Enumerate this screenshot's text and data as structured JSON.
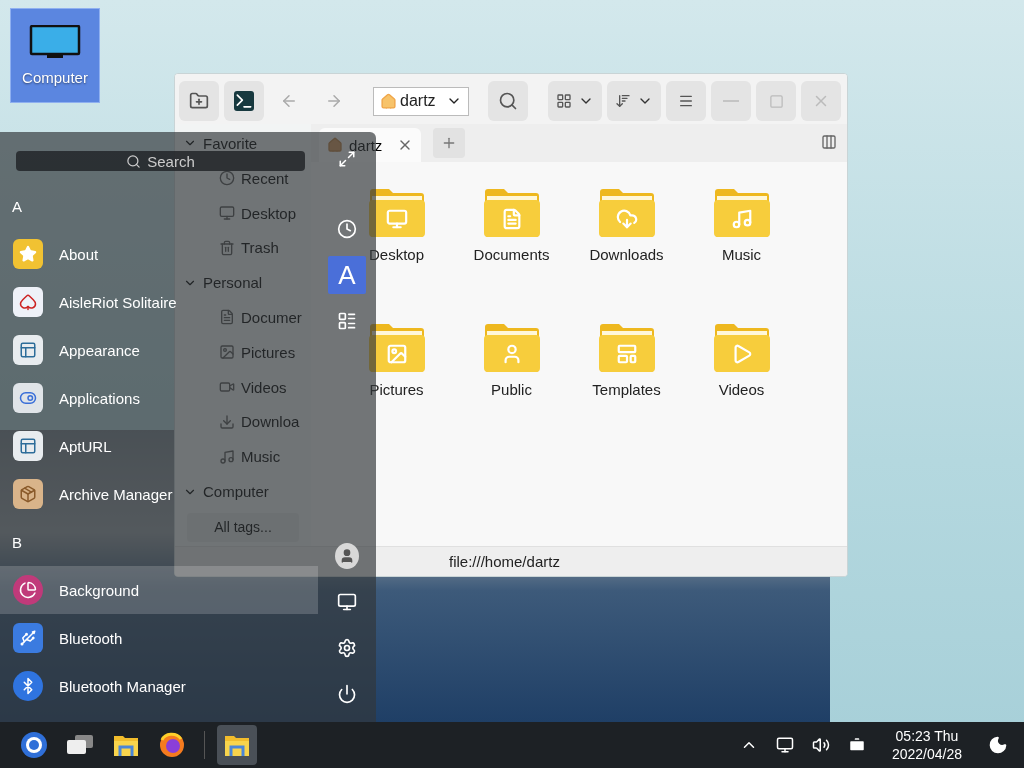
{
  "desktop_icons": [
    {
      "label": "Computer",
      "selected": true
    }
  ],
  "file_manager": {
    "location": "dartz",
    "tabs": [
      {
        "label": "dartz",
        "selected": true
      }
    ],
    "sidebar": [
      {
        "label": "Favorite",
        "expanded": true,
        "children": [
          {
            "label": "Recent",
            "kind": "recent"
          },
          {
            "label": "Desktop",
            "kind": "desktop"
          },
          {
            "label": "Trash",
            "kind": "trash"
          }
        ]
      },
      {
        "label": "Personal",
        "expanded": true,
        "children": [
          {
            "label": "Documer",
            "kind": "documents"
          },
          {
            "label": "Pictures",
            "kind": "pictures"
          },
          {
            "label": "Videos",
            "kind": "videos"
          },
          {
            "label": "Downloa",
            "kind": "downloads"
          },
          {
            "label": "Music",
            "kind": "music"
          }
        ]
      },
      {
        "label": "Computer",
        "expanded": true
      }
    ],
    "tags_button": "All tags...",
    "folders": [
      {
        "name": "Desktop",
        "kind": "desktop"
      },
      {
        "name": "Documents",
        "kind": "documents"
      },
      {
        "name": "Downloads",
        "kind": "downloads"
      },
      {
        "name": "Music",
        "kind": "music"
      },
      {
        "name": "Pictures",
        "kind": "pictures"
      },
      {
        "name": "Public",
        "kind": "public"
      },
      {
        "name": "Templates",
        "kind": "templates"
      },
      {
        "name": "Videos",
        "kind": "videos"
      }
    ],
    "status": "file:///home/dartz"
  },
  "start_menu": {
    "search_placeholder": "Search",
    "groups": [
      {
        "letter": "A",
        "apps": [
          {
            "name": "About",
            "kind": "star",
            "selected": false
          },
          {
            "name": "AisleRiot Solitaire",
            "kind": "cards",
            "selected": false
          },
          {
            "name": "Appearance",
            "kind": "window",
            "selected": false
          },
          {
            "name": "Applications",
            "kind": "toggles",
            "selected": false
          },
          {
            "name": "AptURL",
            "kind": "window",
            "selected": false
          },
          {
            "name": "Archive Manager",
            "kind": "box",
            "selected": false
          }
        ]
      },
      {
        "letter": "B",
        "apps": [
          {
            "name": "Background",
            "kind": "pie",
            "selected": true
          },
          {
            "name": "Bluetooth",
            "kind": "usb",
            "selected": false
          },
          {
            "name": "Bluetooth Manager",
            "kind": "bluetooth",
            "selected": false
          }
        ]
      }
    ],
    "views": [
      {
        "kind": "recent",
        "selected": false
      },
      {
        "kind": "letter",
        "label": "A",
        "selected": true
      },
      {
        "kind": "category",
        "selected": false
      }
    ],
    "actions": [
      {
        "kind": "user"
      },
      {
        "kind": "computer"
      },
      {
        "kind": "settings"
      },
      {
        "kind": "power"
      }
    ]
  },
  "taskbar": {
    "apps": [
      {
        "kind": "launcher",
        "active": false
      },
      {
        "kind": "multitask",
        "active": false
      },
      {
        "kind": "files",
        "active": false
      },
      {
        "kind": "browser",
        "active": false
      },
      {
        "kind": "files",
        "active": true
      }
    ],
    "time": "05:23 Thu",
    "date": "2022/04/28"
  }
}
